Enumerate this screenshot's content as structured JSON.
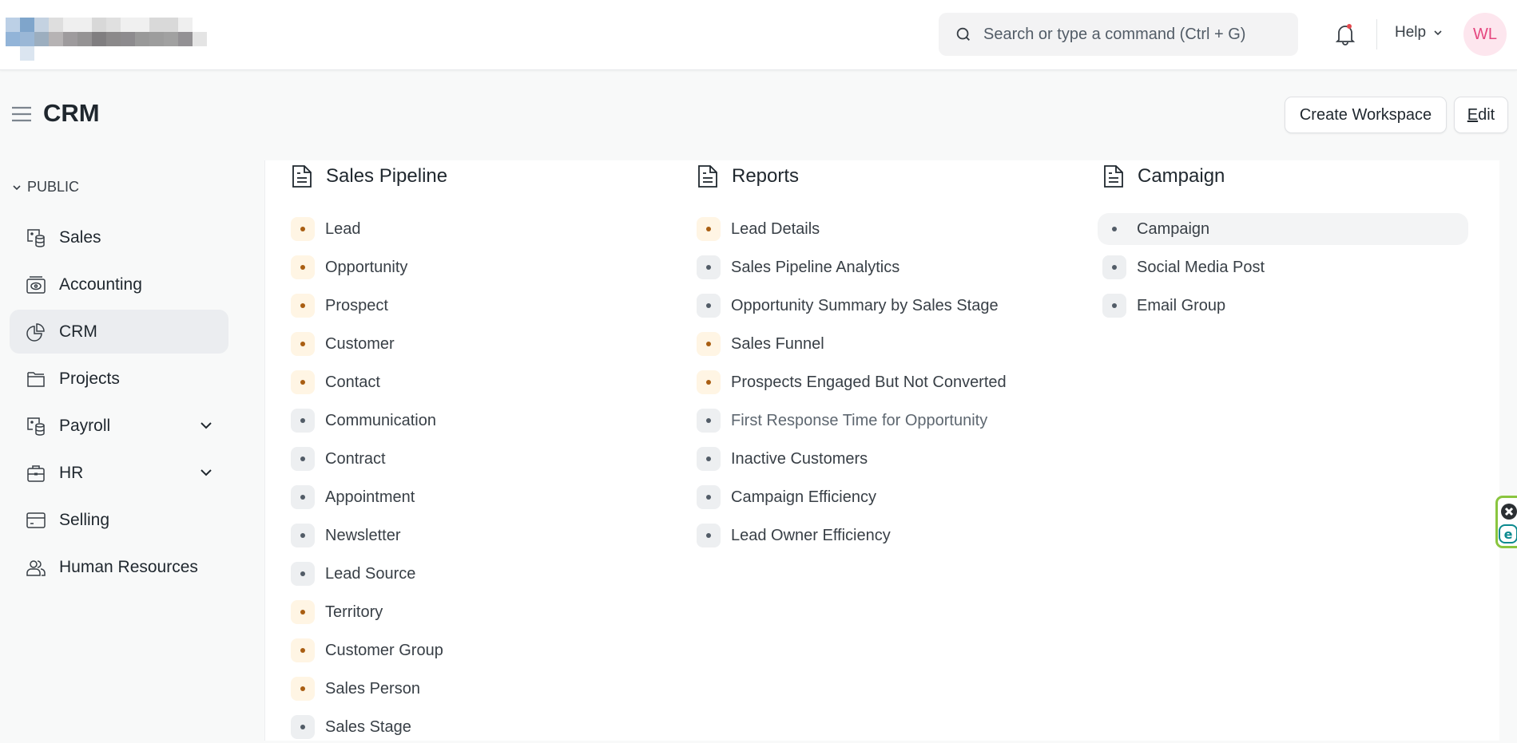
{
  "navbar": {
    "logo_alt": "company-logo (pixelated)",
    "search_placeholder": "Search or type a command (Ctrl + G)",
    "notification_dot_color": "#e5484d",
    "help_label": "Help",
    "avatar_initials": "WL"
  },
  "page": {
    "title": "CRM",
    "create_workspace_label": "Create Workspace",
    "edit_label_underlined": "E",
    "edit_label_rest": "dit"
  },
  "sidebar": {
    "section_label": "PUBLIC",
    "items": [
      {
        "label": "Sales",
        "icon": "sales-icon",
        "active": false,
        "expandable": false
      },
      {
        "label": "Accounting",
        "icon": "accounting-icon",
        "active": false,
        "expandable": false
      },
      {
        "label": "CRM",
        "icon": "crm-pie-icon",
        "active": true,
        "expandable": false
      },
      {
        "label": "Projects",
        "icon": "folder-icon",
        "active": false,
        "expandable": false
      },
      {
        "label": "Payroll",
        "icon": "payroll-icon",
        "active": false,
        "expandable": true
      },
      {
        "label": "HR",
        "icon": "briefcase-icon",
        "active": false,
        "expandable": true
      },
      {
        "label": "Selling",
        "icon": "card-icon",
        "active": false,
        "expandable": false
      },
      {
        "label": "Human Resources",
        "icon": "users-icon",
        "active": false,
        "expandable": false
      }
    ]
  },
  "cards": [
    {
      "title": "Sales Pipeline",
      "links": [
        {
          "label": "Lead",
          "tone": "orange"
        },
        {
          "label": "Opportunity",
          "tone": "orange"
        },
        {
          "label": "Prospect",
          "tone": "orange"
        },
        {
          "label": "Customer",
          "tone": "orange"
        },
        {
          "label": "Contact",
          "tone": "orange"
        },
        {
          "label": "Communication",
          "tone": "gray"
        },
        {
          "label": "Contract",
          "tone": "gray"
        },
        {
          "label": "Appointment",
          "tone": "gray"
        },
        {
          "label": "Newsletter",
          "tone": "gray"
        },
        {
          "label": "Lead Source",
          "tone": "gray"
        },
        {
          "label": "Territory",
          "tone": "orange"
        },
        {
          "label": "Customer Group",
          "tone": "orange"
        },
        {
          "label": "Sales Person",
          "tone": "orange"
        },
        {
          "label": "Sales Stage",
          "tone": "gray"
        }
      ]
    },
    {
      "title": "Reports",
      "links": [
        {
          "label": "Lead Details",
          "tone": "orange"
        },
        {
          "label": "Sales Pipeline Analytics",
          "tone": "gray"
        },
        {
          "label": "Opportunity Summary by Sales Stage",
          "tone": "gray"
        },
        {
          "label": "Sales Funnel",
          "tone": "orange"
        },
        {
          "label": "Prospects Engaged But Not Converted",
          "tone": "orange"
        },
        {
          "label": "First Response Time for Opportunity",
          "tone": "gray",
          "muted": true
        },
        {
          "label": "Inactive Customers",
          "tone": "gray"
        },
        {
          "label": "Campaign Efficiency",
          "tone": "gray"
        },
        {
          "label": "Lead Owner Efficiency",
          "tone": "gray"
        }
      ]
    },
    {
      "title": "Campaign",
      "links": [
        {
          "label": "Campaign",
          "tone": "gray",
          "hovered": true
        },
        {
          "label": "Social Media Post",
          "tone": "gray"
        },
        {
          "label": "Email Group",
          "tone": "gray"
        }
      ]
    }
  ],
  "colors": {
    "orange_dot_bg": "#fff5e4",
    "orange_dot": "#a95e12",
    "gray_dot_bg": "#edeff1",
    "gray_dot": "#525c67",
    "avatar_bg": "#fde6ee",
    "avatar_text": "#e5467f",
    "eset_border": "#8ac53f"
  }
}
